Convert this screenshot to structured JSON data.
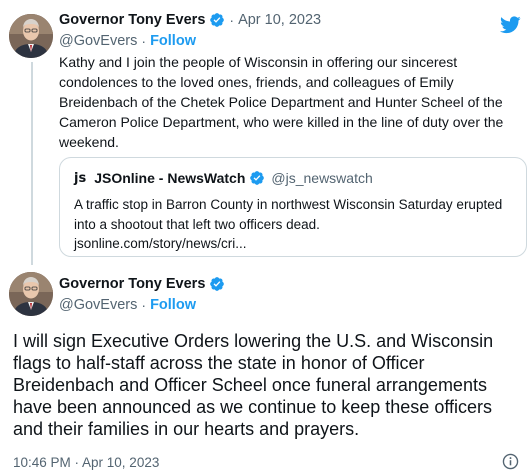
{
  "tweet_one": {
    "author_name": "Governor Tony Evers",
    "date": "Apr 10, 2023",
    "handle": "@GovEvers",
    "follow_label": "Follow",
    "text": "Kathy and I join the people of Wisconsin in offering our sincerest condolences to the loved ones, friends, and colleagues of Emily Breidenbach of the Chetek Police Department and Hunter Scheel of the Cameron Police Department, who were killed in the line of duty over the weekend."
  },
  "quoted_tweet": {
    "logo_text": "js",
    "author_name": "JSOnline - NewsWatch",
    "handle": "@js_newswatch",
    "text": "A traffic stop in Barron County in northwest Wisconsin Saturday erupted into a shootout that left two officers dead.",
    "link": "jsonline.com/story/news/cri..."
  },
  "tweet_two": {
    "author_name": "Governor Tony Evers",
    "handle": "@GovEvers",
    "follow_label": "Follow",
    "text": "I will sign Executive Orders lowering the U.S. and Wisconsin flags to half-staff across the state in honor of Officer Breidenbach and Officer Scheel once funeral arrangements have been announced as we continue to keep these officers and their families in our hearts and prayers.",
    "timestamp": "10:46 PM · Apr 10, 2023"
  },
  "dot_separator": "·",
  "colors": {
    "accent": "#1d9bf0",
    "text": "#0f1419",
    "muted": "#536471",
    "border": "#cfd9de"
  },
  "icons": {
    "verified": "verified-badge-icon",
    "twitter": "twitter-bird-icon",
    "info": "info-icon"
  }
}
